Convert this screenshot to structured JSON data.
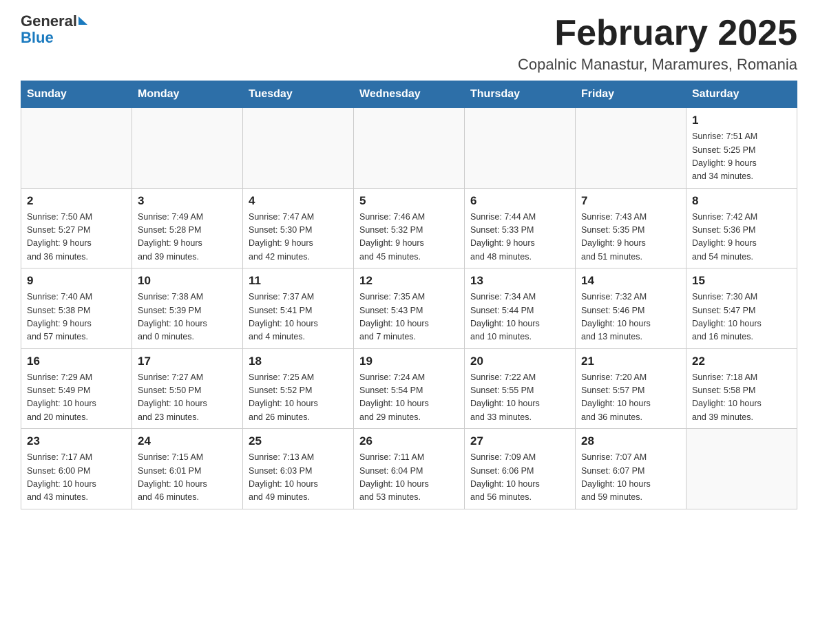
{
  "header": {
    "logo_general": "General",
    "logo_blue": "Blue",
    "month_title": "February 2025",
    "location": "Copalnic Manastur, Maramures, Romania"
  },
  "days_of_week": [
    "Sunday",
    "Monday",
    "Tuesday",
    "Wednesday",
    "Thursday",
    "Friday",
    "Saturday"
  ],
  "weeks": [
    [
      {
        "day": "",
        "info": ""
      },
      {
        "day": "",
        "info": ""
      },
      {
        "day": "",
        "info": ""
      },
      {
        "day": "",
        "info": ""
      },
      {
        "day": "",
        "info": ""
      },
      {
        "day": "",
        "info": ""
      },
      {
        "day": "1",
        "info": "Sunrise: 7:51 AM\nSunset: 5:25 PM\nDaylight: 9 hours\nand 34 minutes."
      }
    ],
    [
      {
        "day": "2",
        "info": "Sunrise: 7:50 AM\nSunset: 5:27 PM\nDaylight: 9 hours\nand 36 minutes."
      },
      {
        "day": "3",
        "info": "Sunrise: 7:49 AM\nSunset: 5:28 PM\nDaylight: 9 hours\nand 39 minutes."
      },
      {
        "day": "4",
        "info": "Sunrise: 7:47 AM\nSunset: 5:30 PM\nDaylight: 9 hours\nand 42 minutes."
      },
      {
        "day": "5",
        "info": "Sunrise: 7:46 AM\nSunset: 5:32 PM\nDaylight: 9 hours\nand 45 minutes."
      },
      {
        "day": "6",
        "info": "Sunrise: 7:44 AM\nSunset: 5:33 PM\nDaylight: 9 hours\nand 48 minutes."
      },
      {
        "day": "7",
        "info": "Sunrise: 7:43 AM\nSunset: 5:35 PM\nDaylight: 9 hours\nand 51 minutes."
      },
      {
        "day": "8",
        "info": "Sunrise: 7:42 AM\nSunset: 5:36 PM\nDaylight: 9 hours\nand 54 minutes."
      }
    ],
    [
      {
        "day": "9",
        "info": "Sunrise: 7:40 AM\nSunset: 5:38 PM\nDaylight: 9 hours\nand 57 minutes."
      },
      {
        "day": "10",
        "info": "Sunrise: 7:38 AM\nSunset: 5:39 PM\nDaylight: 10 hours\nand 0 minutes."
      },
      {
        "day": "11",
        "info": "Sunrise: 7:37 AM\nSunset: 5:41 PM\nDaylight: 10 hours\nand 4 minutes."
      },
      {
        "day": "12",
        "info": "Sunrise: 7:35 AM\nSunset: 5:43 PM\nDaylight: 10 hours\nand 7 minutes."
      },
      {
        "day": "13",
        "info": "Sunrise: 7:34 AM\nSunset: 5:44 PM\nDaylight: 10 hours\nand 10 minutes."
      },
      {
        "day": "14",
        "info": "Sunrise: 7:32 AM\nSunset: 5:46 PM\nDaylight: 10 hours\nand 13 minutes."
      },
      {
        "day": "15",
        "info": "Sunrise: 7:30 AM\nSunset: 5:47 PM\nDaylight: 10 hours\nand 16 minutes."
      }
    ],
    [
      {
        "day": "16",
        "info": "Sunrise: 7:29 AM\nSunset: 5:49 PM\nDaylight: 10 hours\nand 20 minutes."
      },
      {
        "day": "17",
        "info": "Sunrise: 7:27 AM\nSunset: 5:50 PM\nDaylight: 10 hours\nand 23 minutes."
      },
      {
        "day": "18",
        "info": "Sunrise: 7:25 AM\nSunset: 5:52 PM\nDaylight: 10 hours\nand 26 minutes."
      },
      {
        "day": "19",
        "info": "Sunrise: 7:24 AM\nSunset: 5:54 PM\nDaylight: 10 hours\nand 29 minutes."
      },
      {
        "day": "20",
        "info": "Sunrise: 7:22 AM\nSunset: 5:55 PM\nDaylight: 10 hours\nand 33 minutes."
      },
      {
        "day": "21",
        "info": "Sunrise: 7:20 AM\nSunset: 5:57 PM\nDaylight: 10 hours\nand 36 minutes."
      },
      {
        "day": "22",
        "info": "Sunrise: 7:18 AM\nSunset: 5:58 PM\nDaylight: 10 hours\nand 39 minutes."
      }
    ],
    [
      {
        "day": "23",
        "info": "Sunrise: 7:17 AM\nSunset: 6:00 PM\nDaylight: 10 hours\nand 43 minutes."
      },
      {
        "day": "24",
        "info": "Sunrise: 7:15 AM\nSunset: 6:01 PM\nDaylight: 10 hours\nand 46 minutes."
      },
      {
        "day": "25",
        "info": "Sunrise: 7:13 AM\nSunset: 6:03 PM\nDaylight: 10 hours\nand 49 minutes."
      },
      {
        "day": "26",
        "info": "Sunrise: 7:11 AM\nSunset: 6:04 PM\nDaylight: 10 hours\nand 53 minutes."
      },
      {
        "day": "27",
        "info": "Sunrise: 7:09 AM\nSunset: 6:06 PM\nDaylight: 10 hours\nand 56 minutes."
      },
      {
        "day": "28",
        "info": "Sunrise: 7:07 AM\nSunset: 6:07 PM\nDaylight: 10 hours\nand 59 minutes."
      },
      {
        "day": "",
        "info": ""
      }
    ]
  ]
}
